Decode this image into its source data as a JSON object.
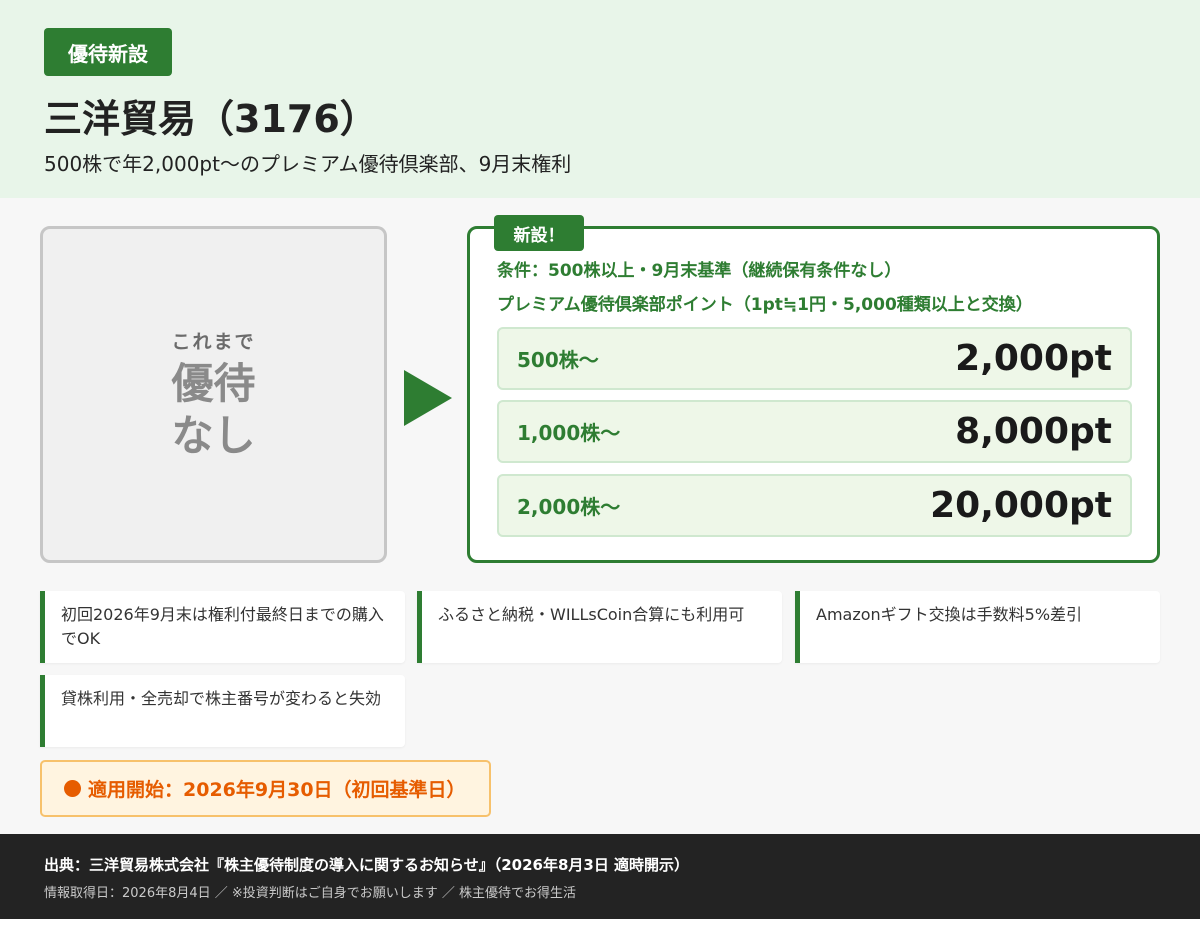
{
  "header": {
    "badge": "優待新設",
    "title": "三洋貿易（3176）",
    "subtitle": "500株で年2,000pt〜のプレミアム優待倶楽部、9月末権利"
  },
  "before": {
    "label": "これまで",
    "value_line1": "優待",
    "value_line2": "なし"
  },
  "new_benefit": {
    "tag": "新設！",
    "condition": "条件：500株以上・9月末基準（継続保有条件なし）",
    "program": "プレミアム優待倶楽部ポイント（1pt≒1円・5,000種類以上と交換）",
    "tiers": [
      {
        "shares": "500株〜",
        "points": "2,000pt"
      },
      {
        "shares": "1,000株〜",
        "points": "8,000pt"
      },
      {
        "shares": "2,000株〜",
        "points": "20,000pt"
      }
    ]
  },
  "notes": [
    "初回2026年9月末は権利付最終日までの購入でOK",
    "ふるさと納税・WILLsCoin合算にも利用可",
    "Amazonギフト交換は手数料5%差引",
    "貸株利用・全売却で株主番号が変わると失効"
  ],
  "start": {
    "text": "適用開始：2026年9月30日（初回基準日）"
  },
  "footer": {
    "source": "出典：三洋貿易株式会社『株主優待制度の導入に関するお知らせ』（2026年8月3日 適時開示）",
    "info": "情報取得日：2026年8月4日 ／ ※投資判断はご自身でお願いします ／ 株主優待でお得生活"
  },
  "colors": {
    "brand_green": "#2e7d32",
    "header_bg": "#e8f5e9",
    "start_orange": "#e65c00",
    "footer_bg": "#232323"
  }
}
